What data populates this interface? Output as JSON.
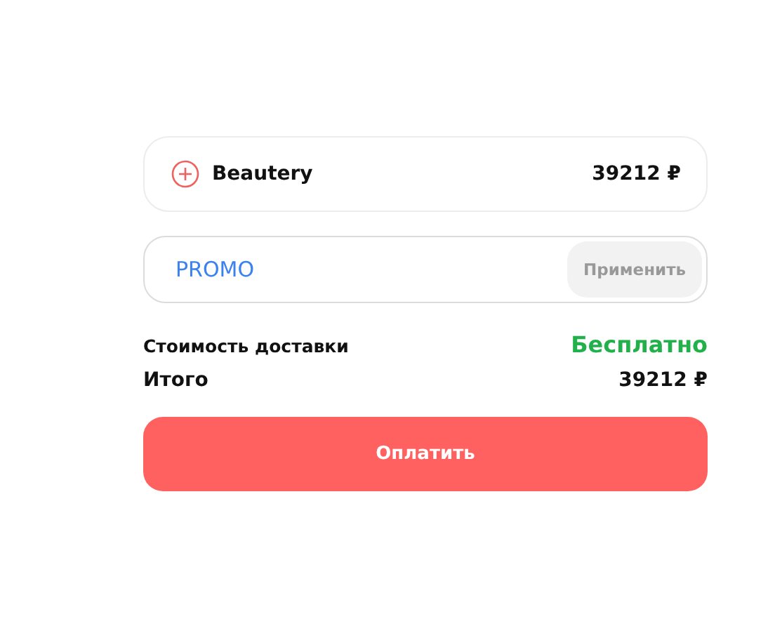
{
  "product": {
    "name": "Beautery",
    "price": "39212 ₽"
  },
  "promo": {
    "value": "PROMO",
    "apply_button": "Применить"
  },
  "summary": [
    {
      "label": "Стоимость доставки",
      "value": "Бесплатно",
      "kind": "free"
    },
    {
      "label": "Итого",
      "value": "39212 ₽",
      "kind": "total"
    }
  ],
  "pay_button": "Оплатить"
}
